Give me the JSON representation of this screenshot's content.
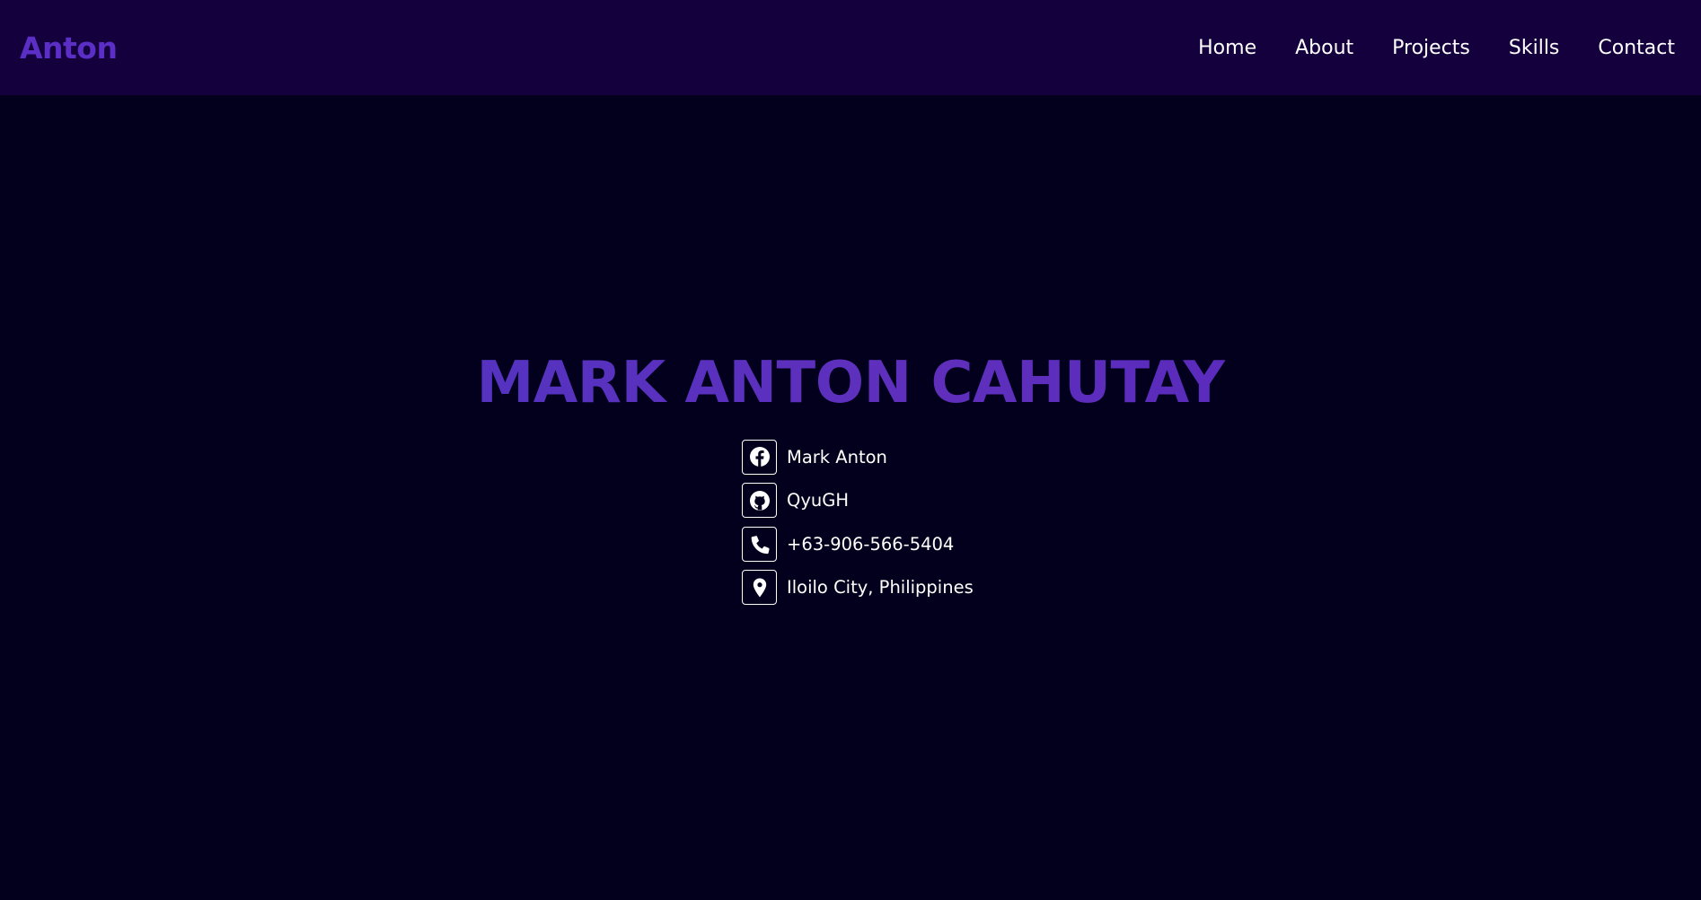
{
  "nav": {
    "brand": "Anton",
    "links": [
      {
        "label": "Home"
      },
      {
        "label": "About"
      },
      {
        "label": "Projects"
      },
      {
        "label": "Skills"
      },
      {
        "label": "Contact"
      }
    ]
  },
  "hero": {
    "title": "MARK ANTON CAHUTAY",
    "contacts": [
      {
        "icon": "facebook-icon",
        "text": "Mark Anton"
      },
      {
        "icon": "github-icon",
        "text": "QyuGH"
      },
      {
        "icon": "phone-icon",
        "text": "+63-906-566-5404"
      },
      {
        "icon": "location-pin-icon",
        "text": "Iloilo City, Philippines"
      }
    ]
  },
  "colors": {
    "background": "#02001c",
    "navbar": "#15003e",
    "accent": "#5b2ec6",
    "text": "#ffffff"
  }
}
